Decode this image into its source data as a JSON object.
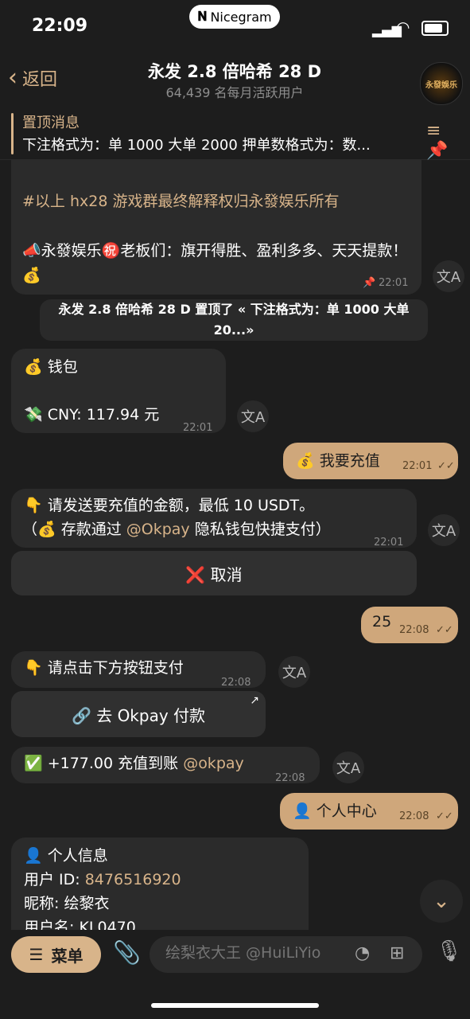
{
  "status": {
    "time": "22:09",
    "carrier": "Nicegram"
  },
  "header": {
    "back_label": "返回",
    "title": "永发 2.8 倍哈希 28 D",
    "subtitle": "64,439 名每月活跃用户",
    "avatar_text": "永發娛乐"
  },
  "pinned": {
    "label": "置顶消息",
    "text": "下注格式为：单 1000 大单 2000 押单数格式为：数..."
  },
  "messages": {
    "rules_tail": "#以上 hx28 游戏群最终解释权归永發娱乐所有",
    "blessing": "📣永發娱乐㊗️老板们：旗开得胜、盈利多多、天天提款！💰",
    "blessing_time": "22:01",
    "service": "永发 2.8 倍哈希 28 D 置顶了 « 下注格式为：单 1000 大单 20...»",
    "wallet_title": "💰 钱包",
    "wallet_balance": "💸 CNY: 117.94 元",
    "wallet_time": "22:01",
    "out_recharge": "💰 我要充值",
    "out_recharge_time": "22:01",
    "prompt_line1": "👇 请发送要充值的金额，最低 10 USDT。",
    "prompt_line2_pre": "（💰 存款通过 ",
    "prompt_line2_link": "@Okpay",
    "prompt_line2_post": " 隐私钱包快捷支付）",
    "prompt_time": "22:01",
    "cancel_button": "❌ 取消",
    "out_amount": "25",
    "out_amount_time": "22:08",
    "pay_prompt": "👇 请点击下方按钮支付",
    "pay_prompt_time": "22:08",
    "pay_button": "🔗 去 Okpay 付款",
    "deposit_pre": "✅ +177.00 充值到账 ",
    "deposit_link": "@okpay",
    "deposit_time": "22:08",
    "out_profile": "👤 个人中心",
    "out_profile_time": "22:08",
    "profile_title": "👤 个人信息",
    "profile_uid_label": "用户 ID: ",
    "profile_uid": "8476516920",
    "profile_nick": "昵称: 绘黎衣",
    "profile_user": "用户名: KL0470"
  },
  "composer": {
    "menu_label": "菜单",
    "placeholder": "绘梨衣大王 @HuiLiYio"
  },
  "colors": {
    "accent": "#d8b48a",
    "background": "#1d1d1d",
    "bubble": "#2b2b2b"
  }
}
